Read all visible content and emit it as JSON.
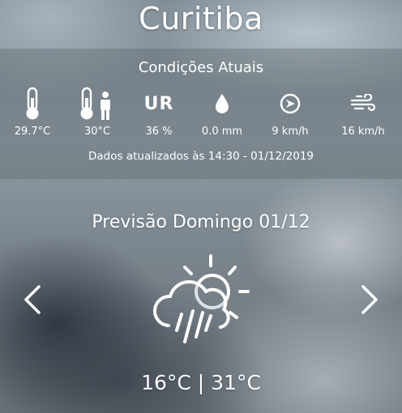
{
  "city": "Curitiba",
  "current": {
    "section_title": "Condições Atuais",
    "items": [
      {
        "icon": "thermometer-icon",
        "value": "29.7°C"
      },
      {
        "icon": "feels-like-icon",
        "value": "30°C"
      },
      {
        "icon": "humidity-icon",
        "label": "UR",
        "value": "36 %"
      },
      {
        "icon": "rain-drop-icon",
        "value": "0.0 mm"
      },
      {
        "icon": "wind-direction-icon",
        "value": "9 km/h"
      },
      {
        "icon": "wind-gust-icon",
        "value": "16 km/h"
      }
    ],
    "updated": "Dados atualizados às 14:30 - 01/12/2019"
  },
  "forecast": {
    "title": "Previsão Domingo 01/12",
    "icon": "sun-cloud-rain-icon",
    "temps": "16°C | 31°C"
  }
}
